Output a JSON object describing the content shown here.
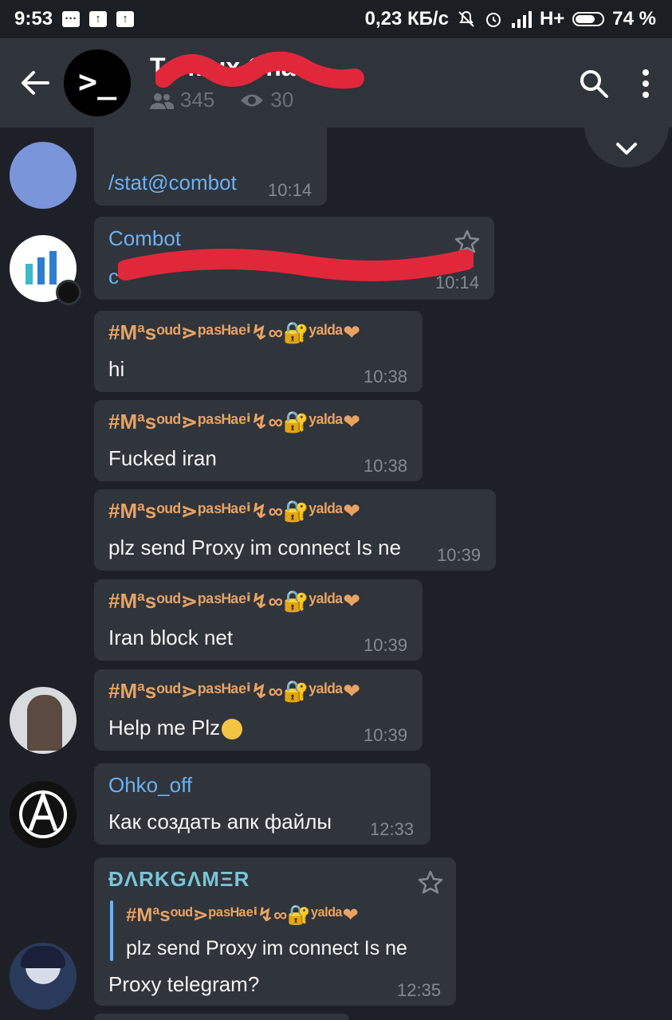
{
  "status_bar": {
    "time": "9:53",
    "speed": "0,23 КБ/с",
    "network": "H+",
    "battery_text": "74 %",
    "battery_level": 0.74
  },
  "header": {
    "title": "Termux Chat",
    "members": "345",
    "online": "30"
  },
  "messages": [
    {
      "text": "/stat@combot",
      "time": "10:14"
    },
    {
      "sender": "Combot",
      "text": "c",
      "time": "10:14"
    },
    {
      "sender": "#Mªsᵒᵘᵈ⋗ᵖᵃˢᴴᵃᵉⁱ↯∞🔐ʸᵃˡᵈᵃ❤",
      "text": "hi",
      "time": "10:38"
    },
    {
      "sender": "#Mªsᵒᵘᵈ⋗ᵖᵃˢᴴᵃᵉⁱ↯∞🔐ʸᵃˡᵈᵃ❤",
      "text": "Fucked iran",
      "time": "10:38"
    },
    {
      "sender": "#Mªsᵒᵘᵈ⋗ᵖᵃˢᴴᵃᵉⁱ↯∞🔐ʸᵃˡᵈᵃ❤",
      "text": "plz send Proxy im connect Is ne",
      "time": "10:39"
    },
    {
      "sender": "#Mªsᵒᵘᵈ⋗ᵖᵃˢᴴᵃᵉⁱ↯∞🔐ʸᵃˡᵈᵃ❤",
      "text": "Iran block net",
      "time": "10:39"
    },
    {
      "sender": "#Mªsᵒᵘᵈ⋗ᵖᵃˢᴴᵃᵉⁱ↯∞🔐ʸᵃˡᵈᵃ❤",
      "text": "Help me Plz",
      "time": "10:39"
    },
    {
      "sender": "Ohko_off",
      "text": "Как создать апк файлы",
      "time": "12:33"
    },
    {
      "sender": "ÐΛRKGΛMΞR",
      "reply_sender": "#Mªsᵒᵘᵈ⋗ᵖᵃˢᴴᵃᵉⁱ↯∞🔐ʸᵃˡᵈᵃ❤",
      "reply_text": "plz send Proxy im connect Is ne",
      "text": "Proxy telegram?",
      "time": "12:35"
    }
  ],
  "colors": {
    "background": "#1d2127",
    "header": "#2f333a",
    "bubble": "#30343b",
    "accent_blue": "#6bb1f2",
    "sender_orange": "#e8a363",
    "redaction": "#e0283a"
  }
}
